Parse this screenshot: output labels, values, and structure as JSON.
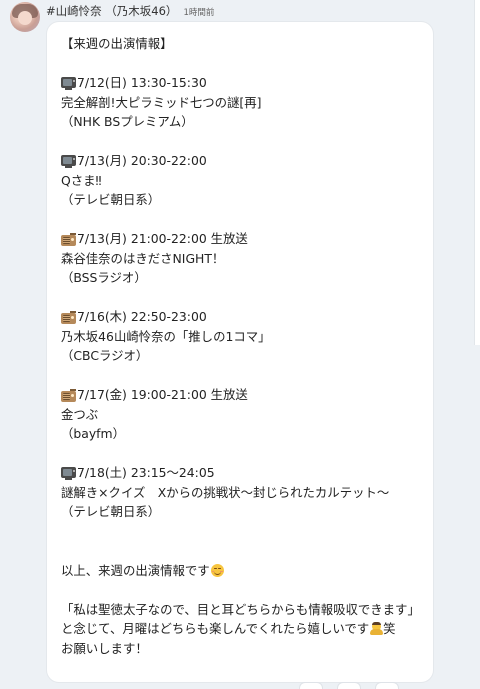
{
  "post": {
    "author": "#山崎怜奈 （乃木坂46）",
    "time": "1時間前",
    "lines": {
      "title": "【来週の出演情報】",
      "s1_time": "7/12(日) 13:30-15:30",
      "s1_name": "完全解剖!大ピラミッド七つの謎[再]",
      "s1_channel": "（NHK BSプレミアム）",
      "s2_time": "7/13(月) 20:30-22:00",
      "s2_name": "Qさま‼︎",
      "s2_channel": "（テレビ朝日系）",
      "s3_time": "7/13(月) 21:00-22:00 生放送",
      "s3_name": "森谷佳奈のはきださNIGHT！",
      "s3_channel": "（BSSラジオ）",
      "s4_time": "7/16(木) 22:50-23:00",
      "s4_name": "乃木坂46山崎怜奈の「推しの1コマ」",
      "s4_channel": "（CBCラジオ）",
      "s5_time": "7/17(金) 19:00-21:00 生放送",
      "s5_name": "金つぶ",
      "s5_channel": "（bayfm）",
      "s6_time": "7/18(土) 23:15〜24:05",
      "s6_name": "謎解き×クイズ　Xからの挑戦状〜封じられたカルテット〜",
      "s6_channel": "（テレビ朝日系）",
      "closing": "以上、来週の出演情報です",
      "quote": "「私は聖徳太子なので、目と耳どちらからも情報吸収できます」",
      "end1": "と念じて、月曜はどちらも楽しんでくれたら嬉しいです",
      "end1_tail": "笑",
      "end2": "お願いします！"
    },
    "icons": {
      "tv": "tv-icon",
      "radio": "radio-icon",
      "smile": "smiling-face-emoji",
      "pray": "praying-person-emoji"
    }
  }
}
